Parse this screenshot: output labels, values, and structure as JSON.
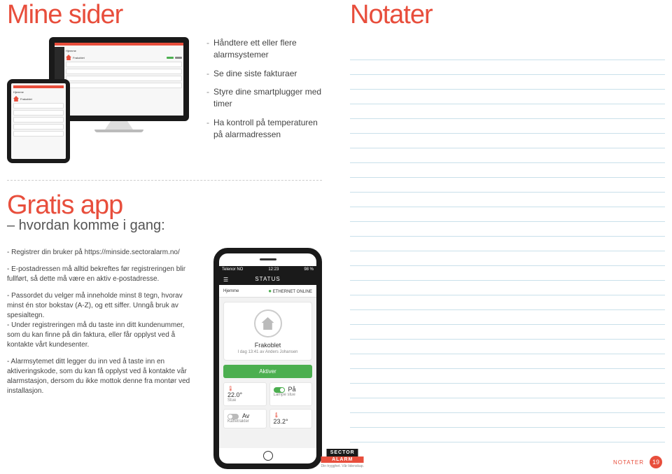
{
  "left": {
    "title1": "Mine sider",
    "bullets": [
      "Håndtere ett eller flere alarmsystemer",
      "Se dine siste fakturaer",
      "Styre dine smartplugger med timer",
      "Ha kontroll på temperaturen på alarmadressen"
    ],
    "title2": "Gratis app",
    "subtitle2": "– hvordan komme i gang:",
    "paragraphs": [
      "- Registrer din bruker på https://minside.sectoralarm.no/",
      "- E-postadressen må alltid bekreftes før registreringen blir fullført, så dette må være en aktiv e-postadresse.",
      "- Passordet du velger må inneholde minst 8 tegn, hvorav minst én stor bokstav (A-Z), og ett siffer. Unngå bruk av spesialtegn.\n- Under registreringen må du taste inn ditt kundenummer, som du kan finne på din faktura, eller får opplyst ved å kontakte vårt kundesenter.",
      "- Alarmsytemet ditt legger du inn ved å taste inn en aktiveringskode, som du kan få opplyst ved å kontakte vår alarmstasjon, dersom du ikke mottok denne fra montør ved installasjon."
    ]
  },
  "phone": {
    "carrier": "Telenor NO",
    "time": "12:23",
    "battery": "98 %",
    "nav_title": "STATUS",
    "address_label": "Hjemme",
    "online_label": "ETHERNET ONLINE",
    "status_title": "Frakoblet",
    "status_sub": "I dag 13:41 av Anders Johansen",
    "activate": "Aktiver",
    "tiles": [
      {
        "big": "22.0°",
        "small": "Stue"
      },
      {
        "big": "På",
        "small": "Lampe stue",
        "toggle": "on"
      },
      {
        "big": "Av",
        "small": "Kaffetrakter",
        "toggle": "off"
      },
      {
        "big": "23.2°",
        "small": ""
      }
    ]
  },
  "mini": {
    "label1": "Hjemme",
    "label2": "Frakoblet"
  },
  "right": {
    "title": "Notater",
    "line_count": 27
  },
  "footer": {
    "label": "NOTATER",
    "page": "19",
    "brand_top": "SECTOR",
    "brand_mid": "ALARM",
    "brand_tag": "Din trygghet. Vår lidenskap."
  }
}
